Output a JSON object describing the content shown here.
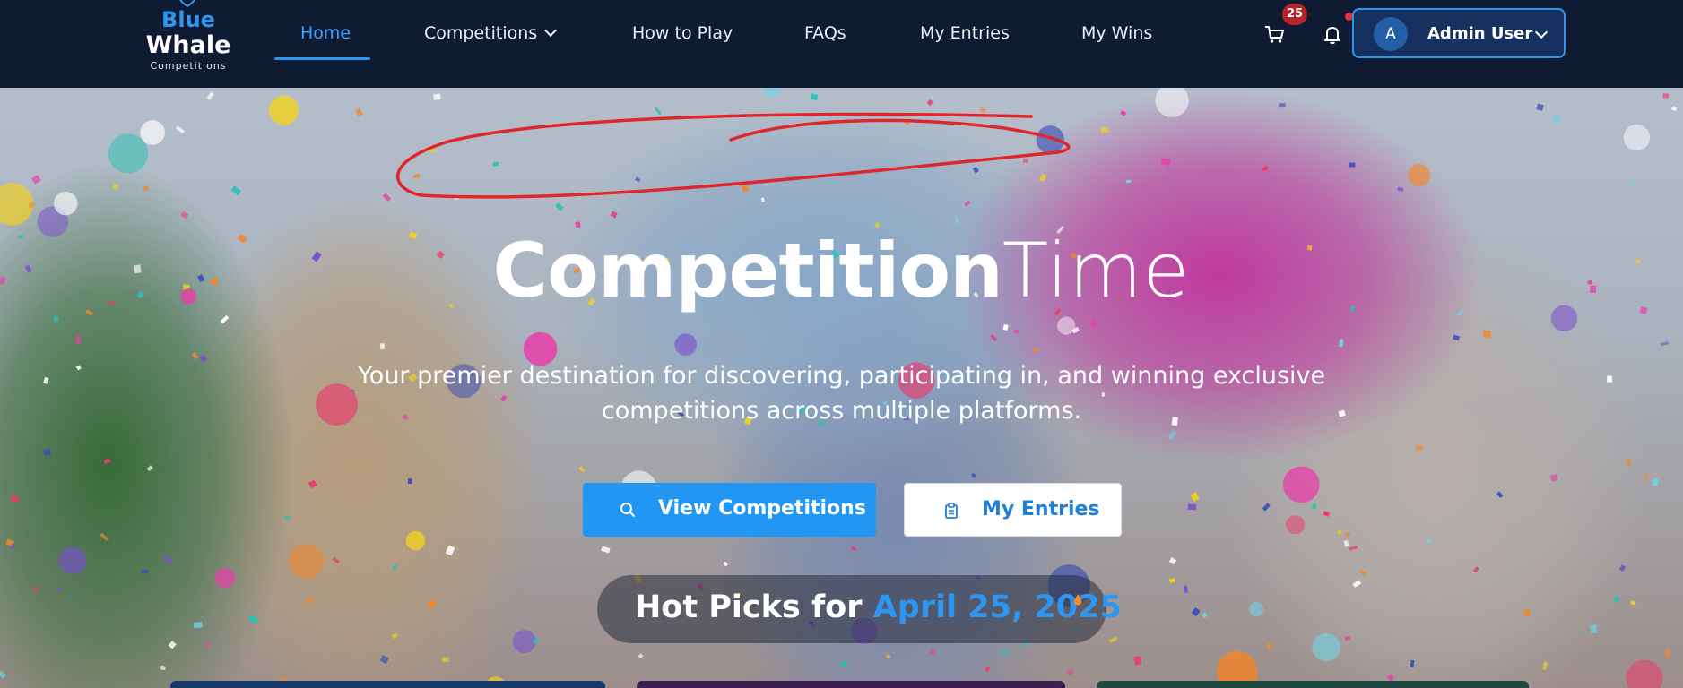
{
  "brand": {
    "line1": "Blue",
    "line2": "Whale",
    "line3": "Competitions"
  },
  "nav": {
    "items": [
      {
        "label": "Home",
        "active": true
      },
      {
        "label": "Competitions",
        "has_dropdown": true
      },
      {
        "label": "How to Play"
      },
      {
        "label": "FAQs"
      },
      {
        "label": "My Entries"
      },
      {
        "label": "My Wins"
      }
    ]
  },
  "header": {
    "cart_count": "25",
    "cart_icon": "cart-icon",
    "notification_icon": "bell-icon",
    "user": {
      "initial": "A",
      "name": "Admin User"
    }
  },
  "hero": {
    "title_bold": "Competition",
    "title_light": "Time",
    "subtitle_line1": "Your premier destination for discovering, participating in, and winning exclusive",
    "subtitle_line2": "competitions across multiple platforms.",
    "primary_button": {
      "label": "View Competitions",
      "icon": "search-icon"
    },
    "secondary_button": {
      "label": "My Entries",
      "icon": "clipboard-icon"
    },
    "hot_picks_label": "Hot Picks for",
    "hot_picks_date": "April 25, 2025"
  },
  "colors": {
    "accent": "#2f96f0",
    "navbar": "#0f1b33",
    "badge": "#b8232a",
    "scribble": "#e0262a"
  }
}
